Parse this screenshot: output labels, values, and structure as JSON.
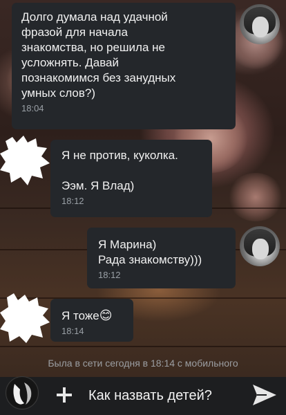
{
  "messages": [
    {
      "side": "right",
      "lines": [
        "Долго думала над удачной",
        "фразой для начала",
        "знакомства, но решила не",
        "усложнять. Давай",
        "познакомимся без занудных",
        "умных слов?)"
      ],
      "time": "18:04"
    },
    {
      "side": "left",
      "lines": [
        "Я не против, куколка.",
        "",
        "Ээм. Я Влад)"
      ],
      "time": "18:12"
    },
    {
      "side": "right",
      "lines": [
        "Я Марина)",
        "Рада знакомству)))"
      ],
      "time": "18:12"
    },
    {
      "side": "left",
      "lines": [
        "Я тоже"
      ],
      "emoji": "😊",
      "time": "18:14"
    }
  ],
  "status": "Была в сети сегодня в 18:14 с мобильного",
  "composer": {
    "text": "Как назвать детей?",
    "attach_icon": "plus-icon",
    "send_icon": "send-icon"
  },
  "colors": {
    "bubble": "#24272b",
    "text": "#f1f1f1",
    "time": "#9aa0a6",
    "input_bar": "#1d1e20"
  }
}
